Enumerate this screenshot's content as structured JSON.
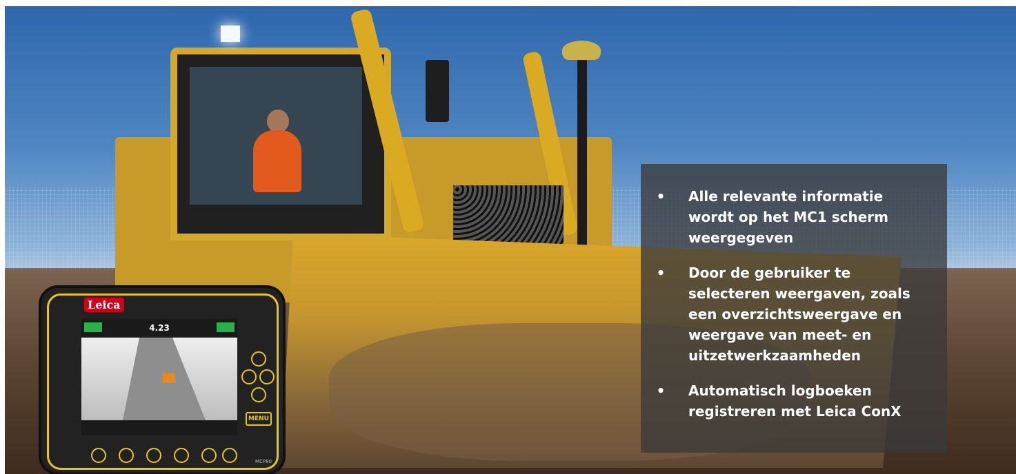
{
  "device": {
    "brand": "Leica",
    "menu_label": "MENU",
    "model": "MCP80",
    "screen_value": "4.23"
  },
  "info_panel": {
    "items": [
      {
        "bullet": "•",
        "text": "Alle relevante informatie wordt op het MC1 scherm weergegeven"
      },
      {
        "bullet": "•",
        "text": "Door de gebruiker te selecteren weergaven, zoals een overzichtsweergave en weergave van meet- en uitzetwerkzaamheden"
      },
      {
        "bullet": "•",
        "text": "Automatisch logboeken registreren met Leica ConX"
      }
    ]
  },
  "colors": {
    "panel_bg": "#3a3a3a",
    "panel_text": "#ffffff",
    "machine_yellow": "#d9aa22",
    "device_accent": "#e6c51c"
  }
}
